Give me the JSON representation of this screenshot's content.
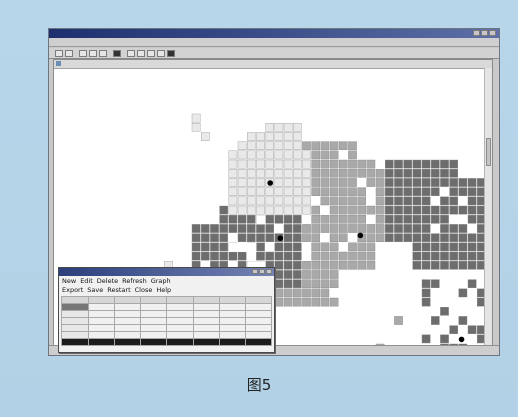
{
  "app": {
    "title": "",
    "menus": [
      "",
      "",
      "",
      ""
    ],
    "toolbar_icons": [
      "open-icon",
      "save-icon",
      "print-icon",
      "copy-icon",
      "pan-icon",
      "select-icon",
      "zoom-in-icon",
      "zoom-out-icon",
      "grid-icon",
      "measure-icon",
      "info-icon"
    ]
  },
  "map_window": {
    "title": "",
    "status_left": "",
    "status_right": "",
    "palette": {
      "light": "#e9e9e9",
      "mid": "#a9a9a9",
      "dark": "#6d6d6d",
      "point": "#000000"
    }
  },
  "stats_window": {
    "title": "",
    "menu_row1": [
      "New",
      "Edit",
      "Delete",
      "Refresh",
      "Graph"
    ],
    "menu_row2": [
      "Export",
      "Save",
      "Restart",
      "Close",
      "Help"
    ],
    "table": {
      "headers": [
        "",
        "",
        "",
        "",
        "",
        "",
        "",
        ""
      ],
      "rows": [
        [
          "",
          "",
          "",
          "",
          "",
          "",
          "",
          ""
        ],
        [
          "",
          "",
          "",
          "",
          "",
          "",
          "",
          ""
        ],
        [
          "",
          "",
          "",
          "",
          "",
          "",
          "",
          ""
        ],
        [
          "",
          "",
          "",
          "",
          "",
          "",
          "",
          ""
        ],
        [
          "",
          "",
          "",
          "",
          "",
          "",
          "",
          ""
        ],
        [
          "",
          "",
          "",
          "",
          "",
          "",
          "",
          ""
        ]
      ]
    }
  },
  "caption": "图5"
}
